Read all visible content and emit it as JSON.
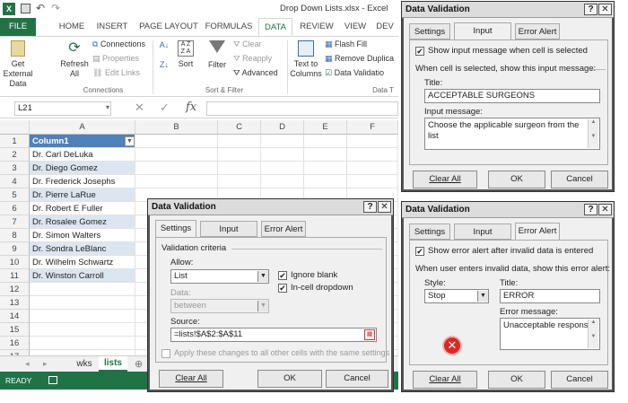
{
  "excel": {
    "window_title": "Drop Down Lists.xlsx - Excel",
    "tabs": [
      "FILE",
      "HOME",
      "INSERT",
      "PAGE LAYOUT",
      "FORMULAS",
      "DATA",
      "REVIEW",
      "VIEW",
      "DEV"
    ],
    "ribbon": {
      "get_external": "Get External",
      "get_external2": "Data",
      "refresh": "Refresh",
      "refresh2": "All",
      "connections": "Connections",
      "properties": "Properties",
      "edit_links": "Edit Links",
      "group_connections": "Connections",
      "sort": "Sort",
      "filter": "Filter",
      "clear": "Clear",
      "reapply": "Reapply",
      "advanced": "Advanced",
      "group_sort": "Sort & Filter",
      "text_to": "Text to",
      "columns": "Columns",
      "flash_fill": "Flash Fill",
      "remove_dup": "Remove Duplica",
      "data_validation": "Data Validatio",
      "group_data": "Data T"
    },
    "name_box": "L21",
    "fx": "fx",
    "columns": [
      "A",
      "B",
      "C",
      "D",
      "E",
      "F"
    ],
    "rows": [
      "1",
      "2",
      "3",
      "4",
      "5",
      "6",
      "7",
      "8",
      "9",
      "10",
      "11",
      "12",
      "13",
      "14",
      "15",
      "16",
      "17"
    ],
    "cells": [
      "Column1",
      "Dr. Carl DeLuka",
      "Dr. Diego Gomez",
      "Dr. Frederick Josephs",
      "Dr. Pierre LaRue",
      "Dr. Robert E Fuller",
      "Dr. Rosalee Gomez",
      "Dr. Simon Walters",
      "Dr. Sondra LeBlanc",
      "Dr. Wilhelm Schwartz",
      "Dr. Winston Carroll"
    ],
    "sheets": [
      "wks",
      "lists"
    ],
    "status": "READY"
  },
  "dv_settings": {
    "title": "Data Validation",
    "tabs": [
      "Settings",
      "Input Message",
      "Error Alert"
    ],
    "criteria": "Validation criteria",
    "allow_label": "Allow:",
    "allow_value": "List",
    "data_label": "Data:",
    "data_value": "between",
    "ignore_blank": "Ignore blank",
    "in_cell": "In-cell dropdown",
    "source_label": "Source:",
    "source_value": "=lists!$A$2:$A$11",
    "apply_all": "Apply these changes to all other cells with the same settings",
    "clear_all": "Clear All",
    "ok": "OK",
    "cancel": "Cancel"
  },
  "dv_input": {
    "title": "Data Validation",
    "tabs": [
      "Settings",
      "Input Message",
      "Error Alert"
    ],
    "show_msg": "Show input message when cell is selected",
    "when_selected": "When cell is selected, show this input message:",
    "title_label": "Title:",
    "title_value": "ACCEPTABLE SURGEONS",
    "msg_label": "Input message:",
    "msg_value": "Choose the applicable surgeon from the list",
    "clear_all": "Clear All",
    "ok": "OK",
    "cancel": "Cancel"
  },
  "dv_error": {
    "title": "Data Validation",
    "tabs": [
      "Settings",
      "Input Message",
      "Error Alert"
    ],
    "show_alert": "Show error alert after invalid data is entered",
    "when_invalid": "When user enters invalid data, show this error alert:",
    "style_label": "Style:",
    "style_value": "Stop",
    "title_label": "Title:",
    "title_value": "ERROR",
    "msg_label": "Error message:",
    "msg_value": "Unacceptable response",
    "clear_all": "Clear All",
    "ok": "OK",
    "cancel": "Cancel"
  },
  "colors": {
    "excel_green": "#217346",
    "header_blue": "#4f81bd",
    "band_blue": "#dce6f1"
  }
}
